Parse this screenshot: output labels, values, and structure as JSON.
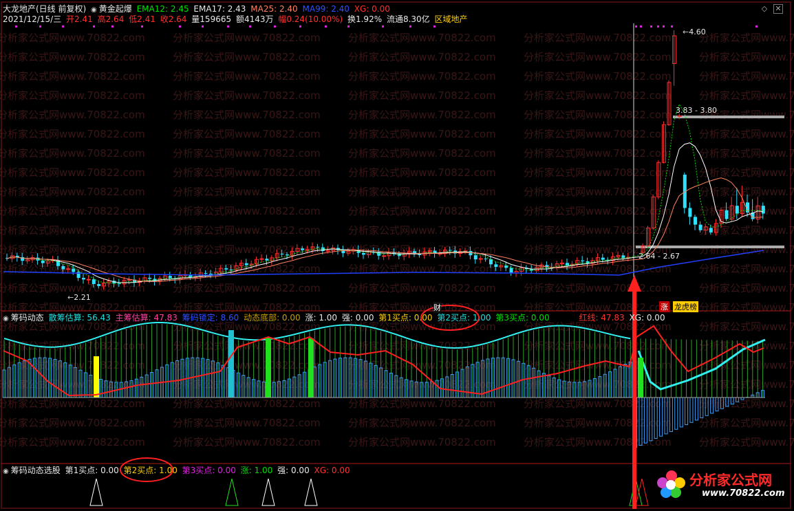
{
  "header": {
    "stock_title": "大龙地产(日线 前复权)",
    "indicator_name": "黄金起爆",
    "ema12": "EMA12: 2.45",
    "ema17": "EMA17: 2.43",
    "ma25": "MA25: 2.40",
    "ma99": "MA99: 2.40",
    "xg": "XG: 0.00",
    "date": "2021/12/15/三",
    "open": "开2.41",
    "high": "高2.64",
    "low": "低2.41",
    "close": "收2.64",
    "volume": "量159665",
    "amount": "额4143万",
    "change": "幅0.24(10.00%)",
    "turnover": "换1.92%",
    "float": "流通8.30亿",
    "sector": "区域地产"
  },
  "price_labels": {
    "high_peak": "4.60",
    "low_point": "2.21",
    "range_upper": "3.83 - 3.80",
    "range_lower": "2.64 - 2.67",
    "fin_tag": "财",
    "zhang_tag": "涨",
    "list_tag": "龙虎榜"
  },
  "panel2": {
    "name": "筹码动态",
    "sanchou": "散筹估算: 56.43",
    "zhuchou": "主筹估算: 47.83",
    "suoding": "筹码锁定: 8.60",
    "dongtai": "动态底部: 0.00",
    "zhang": "涨: 1.00",
    "qiang": "强: 0.00",
    "buy1": "第1买点: 0.00",
    "buy2": "第2买点: 1.00",
    "buy3": "第3买点: 0.00",
    "hongxian": "红线: 47.83",
    "xg": "XG: 0.00"
  },
  "panel3": {
    "name": "筹码动态选股",
    "buy1": "第1买点: 0.00",
    "buy2": "第2买点: 1.00",
    "buy3": "第3买点: 0.00",
    "zhang": "涨: 1.00",
    "qiang": "强: 0.00",
    "xg": "XG: 0.00"
  },
  "watermark": "分析家公式网www.70822.com",
  "logo": {
    "name": "分析家公式网",
    "url": "www.70822.com"
  },
  "colors": {
    "up": "#ff3030",
    "down": "#30e0ff",
    "ema12": "#00e000",
    "ema17": "#ffffff",
    "ma25": "#ff8060",
    "ma99": "#2040ff"
  }
}
